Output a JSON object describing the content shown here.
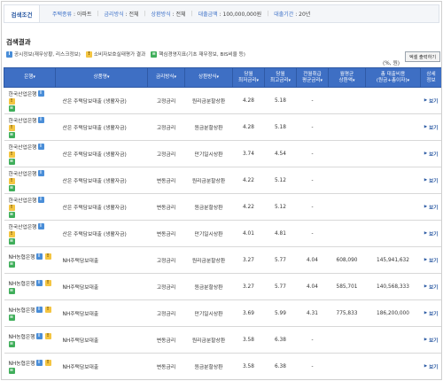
{
  "conditions": {
    "title": "검색조건",
    "items": [
      {
        "key": "주택종류",
        "value": "아파트"
      },
      {
        "key": "금리방식",
        "value": "전체"
      },
      {
        "key": "상환방식",
        "value": "전체"
      },
      {
        "key": "대출금액",
        "value": "100,000,000원"
      },
      {
        "key": "대출기간",
        "value": "20년"
      }
    ]
  },
  "results": {
    "title": "검색결과",
    "legend": [
      {
        "badge": "i",
        "text": "공시정보(재무상황, 리스크정보)"
      },
      {
        "badge": "s",
        "text": "소비자보호실태평가 결과"
      },
      {
        "badge": "c",
        "text": "핵심경영지표(기초 재무정보, BIS비율 등)"
      }
    ],
    "unit": "(%, 원)",
    "print_button": "엑셀 출력하기"
  },
  "table": {
    "headers": [
      {
        "label": "은행",
        "sort": "▾"
      },
      {
        "label": "상품명",
        "sort": "▾"
      },
      {
        "label": "금리방식",
        "sort": "▾"
      },
      {
        "label": "상환방식",
        "sort": "▾"
      },
      {
        "label": "당월\n최저금리",
        "sort": "▾"
      },
      {
        "label": "당월\n최고금리",
        "sort": "▾"
      },
      {
        "label": "전월취급\n평균금리",
        "sort": "▾"
      },
      {
        "label": "월평균\n상환액",
        "sort": "▾"
      },
      {
        "label": "총 대출비용\n(원금+총이자)",
        "sort": "▾"
      },
      {
        "label": "상세\n정보",
        "sort": ""
      }
    ],
    "view_label": "보기",
    "rows": [
      {
        "bank": "한국산업은행",
        "product": "산은 주택담보대출 (생활자금)",
        "rate_type": "고정금리",
        "repay": "원리금분할상환",
        "min": "4.28",
        "max": "5.18",
        "avg": "-",
        "monthly": "",
        "total": ""
      },
      {
        "bank": "한국산업은행",
        "product": "산은 주택담보대출 (생활자금)",
        "rate_type": "고정금리",
        "repay": "원금분할상환",
        "min": "4.28",
        "max": "5.18",
        "avg": "-",
        "monthly": "",
        "total": ""
      },
      {
        "bank": "한국산업은행",
        "product": "산은 주택담보대출 (생활자금)",
        "rate_type": "고정금리",
        "repay": "만기일시상환",
        "min": "3.74",
        "max": "4.54",
        "avg": "-",
        "monthly": "",
        "total": ""
      },
      {
        "bank": "한국산업은행",
        "product": "산은 주택담보대출 (생활자금)",
        "rate_type": "변동금리",
        "repay": "원리금분할상환",
        "min": "4.22",
        "max": "5.12",
        "avg": "-",
        "monthly": "",
        "total": ""
      },
      {
        "bank": "한국산업은행",
        "product": "산은 주택담보대출 (생활자금)",
        "rate_type": "변동금리",
        "repay": "원금분할상환",
        "min": "4.22",
        "max": "5.12",
        "avg": "-",
        "monthly": "",
        "total": ""
      },
      {
        "bank": "한국산업은행",
        "product": "산은 주택담보대출 (생활자금)",
        "rate_type": "변동금리",
        "repay": "만기일시상환",
        "min": "4.01",
        "max": "4.81",
        "avg": "-",
        "monthly": "",
        "total": ""
      },
      {
        "bank": "NH농협은행",
        "product": "NH주택담보대출",
        "rate_type": "고정금리",
        "repay": "원리금분할상환",
        "min": "3.27",
        "max": "5.77",
        "avg": "4.04",
        "monthly": "608,090",
        "total": "145,941,632"
      },
      {
        "bank": "NH농협은행",
        "product": "NH주택담보대출",
        "rate_type": "고정금리",
        "repay": "원금분할상환",
        "min": "3.27",
        "max": "5.77",
        "avg": "4.04",
        "monthly": "585,701",
        "total": "140,568,333"
      },
      {
        "bank": "NH농협은행",
        "product": "NH주택담보대출",
        "rate_type": "고정금리",
        "repay": "만기일시상환",
        "min": "3.69",
        "max": "5.99",
        "avg": "4.31",
        "monthly": "775,833",
        "total": "186,200,000"
      },
      {
        "bank": "NH농협은행",
        "product": "NH주택담보대출",
        "rate_type": "변동금리",
        "repay": "원리금분할상환",
        "min": "3.58",
        "max": "6.38",
        "avg": "-",
        "monthly": "",
        "total": ""
      },
      {
        "bank": "NH농협은행",
        "product": "NH주택담보대출",
        "rate_type": "변동금리",
        "repay": "원금분할상환",
        "min": "3.58",
        "max": "6.38",
        "avg": "-",
        "monthly": "",
        "total": ""
      }
    ]
  },
  "colors": {
    "header_bg": "#3e6fc4",
    "accent": "#2b5aa3",
    "badge_info": "#4a8ed8",
    "badge_survey": "#f4c542",
    "badge_core": "#3fae5a"
  },
  "icons": {
    "info_badge": "i",
    "survey_badge": "!",
    "core_badge": "≡",
    "view_arrow": "▶"
  }
}
